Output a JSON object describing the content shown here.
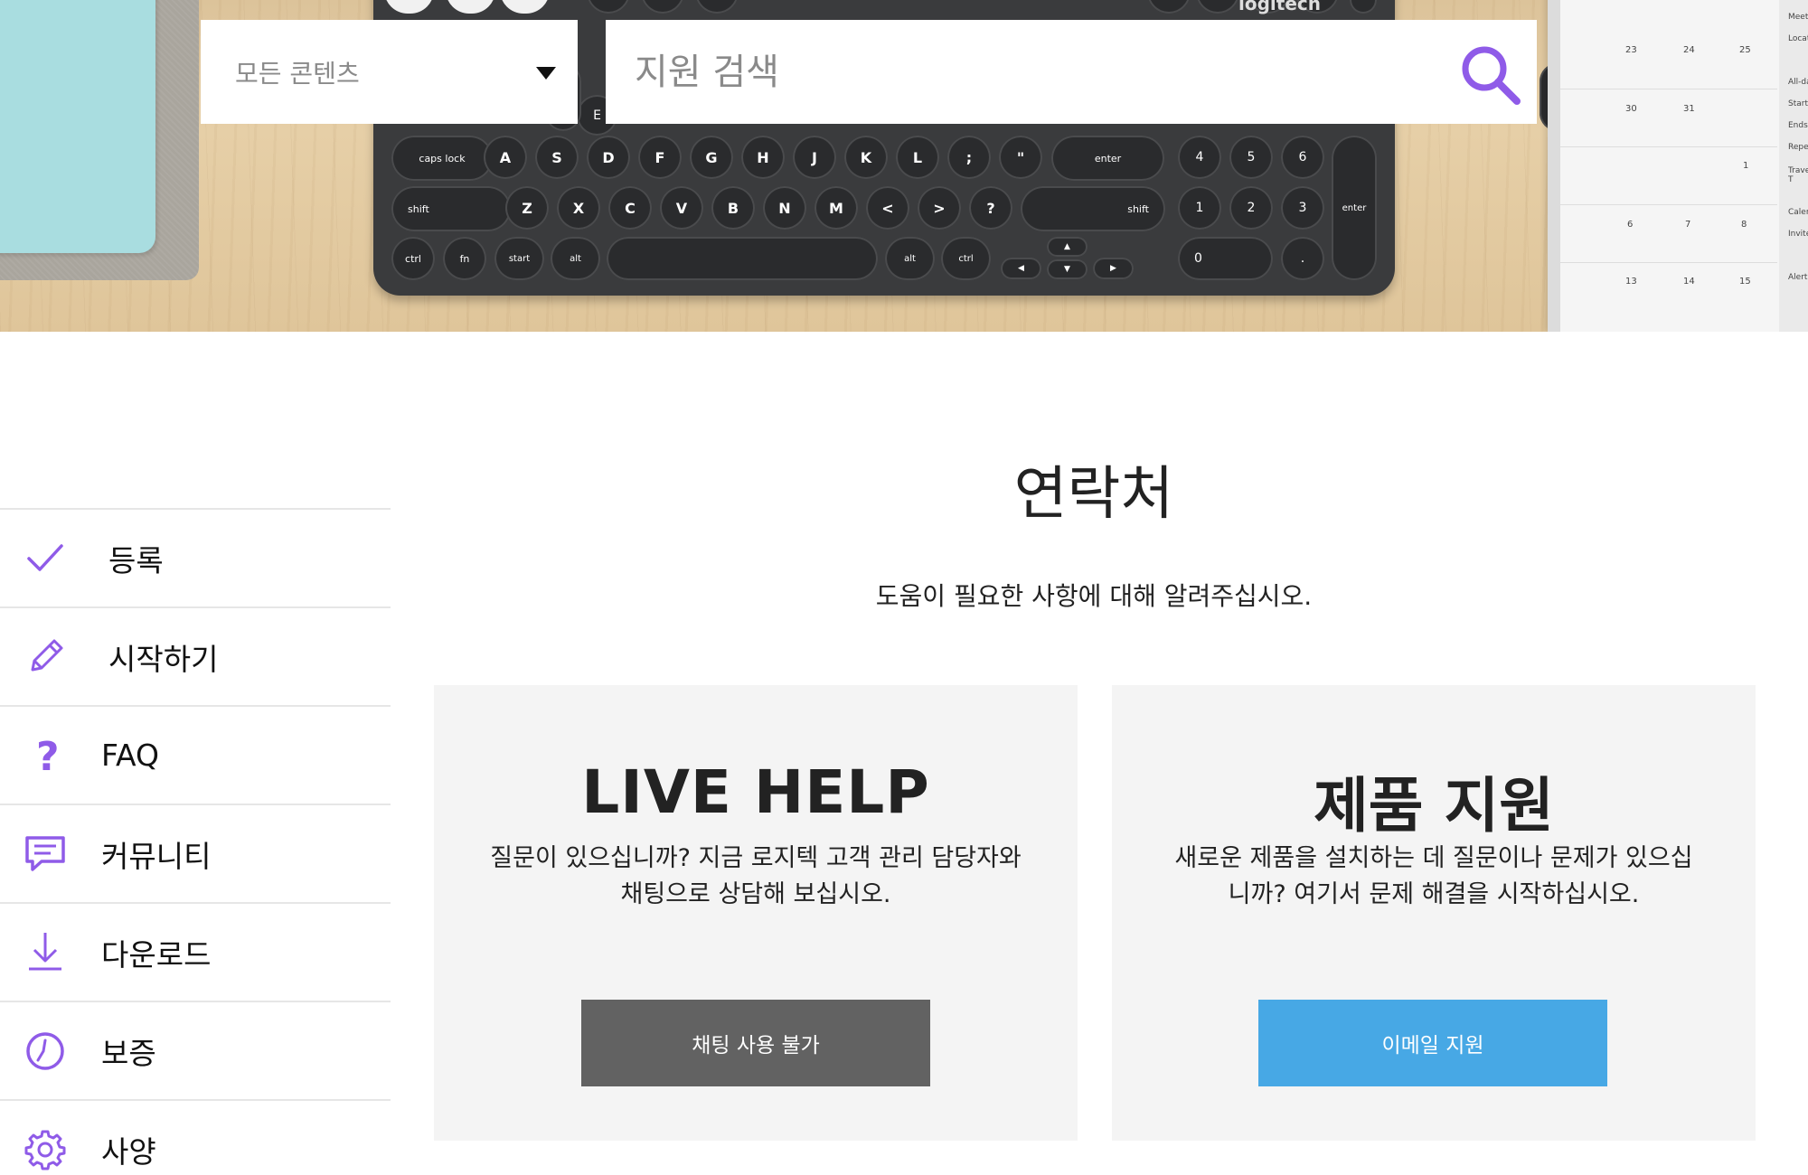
{
  "search": {
    "scope_label": "모든 콘텐츠",
    "placeholder": "지원 검색"
  },
  "hero": {
    "brand_text": "logitech"
  },
  "sidebar": {
    "items": [
      {
        "label": "등록",
        "icon": "checkmark-icon"
      },
      {
        "label": "시작하기",
        "icon": "pencil-icon"
      },
      {
        "label": "FAQ",
        "icon": "question-mark-icon"
      },
      {
        "label": "커뮤니티",
        "icon": "chat-bubble-icon"
      },
      {
        "label": "다운로드",
        "icon": "download-icon"
      },
      {
        "label": "보증",
        "icon": "warranty-clock-icon"
      },
      {
        "label": "사양",
        "icon": "gear-icon"
      }
    ]
  },
  "main": {
    "title": "연락처",
    "subtitle": "도움이 필요한 사항에 대해 알려주십시오.",
    "cards": [
      {
        "title": "LIVE HELP",
        "desc_line1": "질문이 있으십니까? 지금 로지텍 고객 관리 담당자와",
        "desc_line2": "채팅으로 상담해 보십시오.",
        "button": "채팅 사용 불가"
      },
      {
        "title": "제품 지원",
        "desc_line1": "새로운 제품을 설치하는 데 질문이나 문제가 있으십",
        "desc_line2": "니까? 여기서 문제 해결을 시작하십시오.",
        "button": "이메일 지원"
      }
    ]
  },
  "colors": {
    "accent": "#8f5be8",
    "email_button": "#47a8e5",
    "chat_button": "#626262",
    "card_bg": "#f4f4f4"
  }
}
